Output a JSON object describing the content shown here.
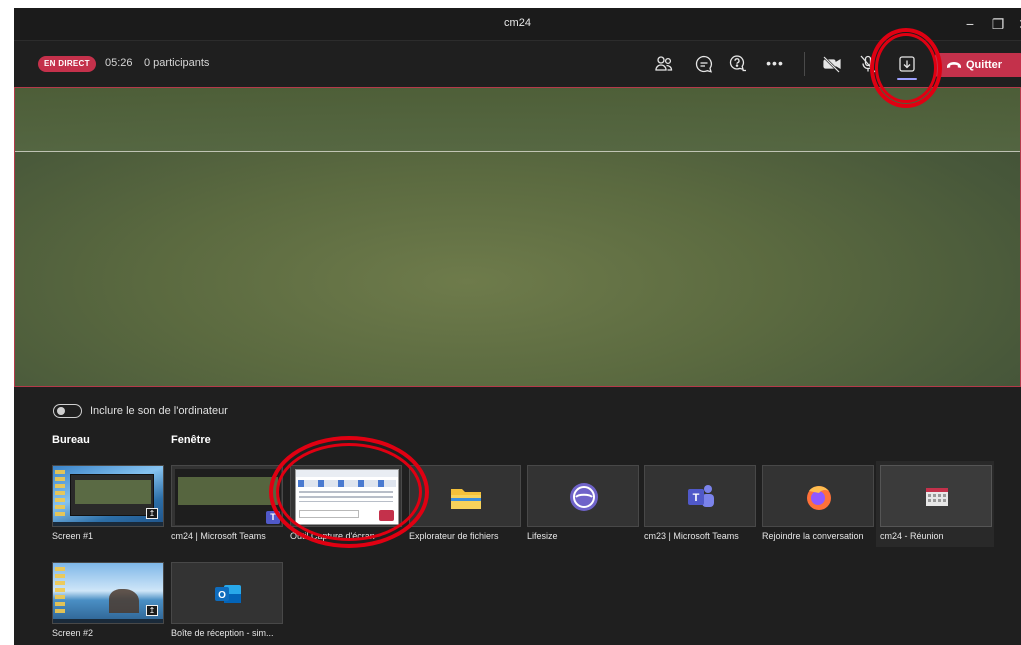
{
  "window": {
    "title": "cm24",
    "minimize_glyph": "−",
    "maximize_glyph": "❐",
    "close_glyph": "✕"
  },
  "toolbar": {
    "live_badge": "EN DIRECT",
    "timer": "05:26",
    "participants": "0 participants",
    "more_glyph": "•••",
    "leave_label": "Quitter",
    "icons": [
      "people-icon",
      "chat-icon",
      "question-answer-icon",
      "more-icon",
      "camera-off-icon",
      "mic-off-icon",
      "share-tray-icon",
      "hang-up-icon"
    ]
  },
  "share_tray": {
    "include_sound_label": "Inclure le son de l'ordinateur",
    "include_sound_on": false,
    "section_desktop": "Bureau",
    "section_window": "Fenêtre",
    "tiles": [
      {
        "label": "Screen #1"
      },
      {
        "label": "cm24 | Microsoft Teams"
      },
      {
        "label": "Outil Capture d'écran"
      },
      {
        "label": "Explorateur de fichiers"
      },
      {
        "label": "Lifesize"
      },
      {
        "label": "cm23 | Microsoft Teams"
      },
      {
        "label": "Rejoindre la conversation"
      },
      {
        "label": "cm24 - Réunion"
      },
      {
        "label": "Screen #2"
      },
      {
        "label": "Boîte de réception - sim..."
      }
    ]
  },
  "colors": {
    "live_red": "#c4314b",
    "leave_red": "#c4314b",
    "share_accent": "#9ea2ff",
    "annotation_red": "#e00012",
    "background": "#1f1f1f"
  }
}
